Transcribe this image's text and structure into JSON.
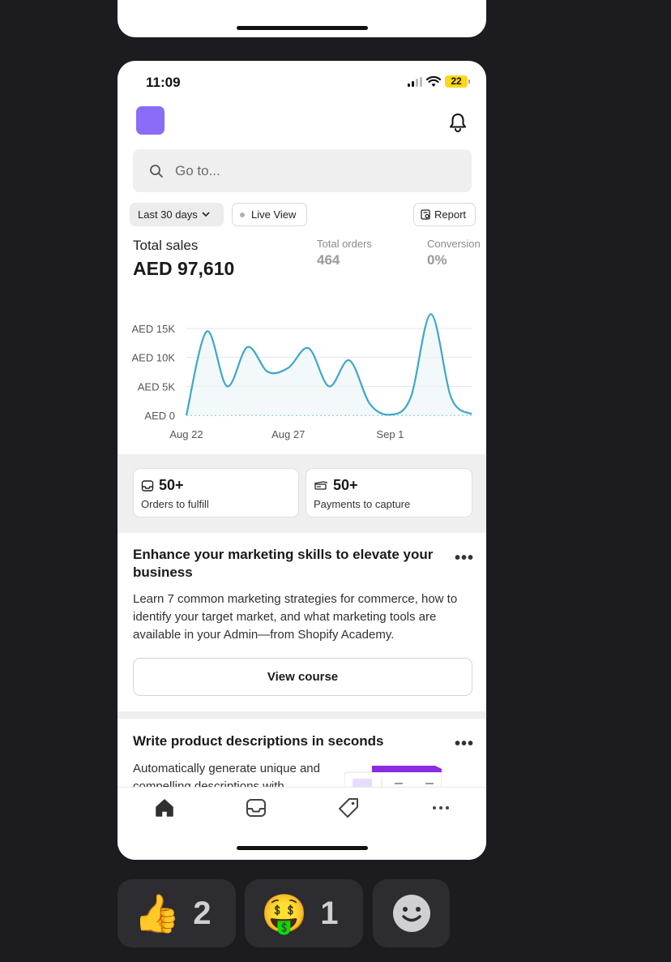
{
  "status_bar": {
    "time": "11:09",
    "battery": "22"
  },
  "search": {
    "placeholder": "Go to..."
  },
  "filters": {
    "date_range": "Last 30 days",
    "live_view": "Live View",
    "report": "Report"
  },
  "metrics": {
    "total_sales_label": "Total sales",
    "total_sales_value": "AED 97,610",
    "total_orders_label": "Total orders",
    "total_orders_value": "464",
    "conversion_label": "Conversion",
    "conversion_value": "0%"
  },
  "chart_data": {
    "type": "line",
    "title": "",
    "xlabel": "",
    "ylabel": "",
    "y_ticks": [
      "AED 15K",
      "AED 10K",
      "AED 5K",
      "AED 0"
    ],
    "x_ticks": [
      "Aug 22",
      "Aug 27",
      "Sep 1"
    ],
    "ylim": [
      0,
      15000
    ],
    "grid": true,
    "color": "#3ea7c9",
    "x": [
      "Aug 22",
      "Aug 23",
      "Aug 24",
      "Aug 25",
      "Aug 26",
      "Aug 27",
      "Aug 28",
      "Aug 29",
      "Aug 30",
      "Aug 31",
      "Sep 1",
      "Sep 2",
      "Sep 3",
      "Sep 4",
      "Sep 5"
    ],
    "values": [
      0,
      14500,
      5000,
      11800,
      7500,
      8200,
      11600,
      5000,
      9500,
      2000,
      100,
      3000,
      17500,
      3000,
      200
    ]
  },
  "tasks": [
    {
      "count": "50+",
      "label": "Orders to fulfill",
      "icon": "inbox-icon"
    },
    {
      "count": "50+",
      "label": "Payments to capture",
      "icon": "cash-icon"
    }
  ],
  "marketing_card": {
    "title": "Enhance your marketing skills to elevate your business",
    "body": "Learn 7 common marketing strategies for commerce, how to identify your target market, and what marketing tools are available in your Admin—from Shopify Academy.",
    "button": "View course",
    "more": "•••"
  },
  "product_card": {
    "title": "Write product descriptions in seconds",
    "body": "Automatically generate unique and compelling descriptions with",
    "more": "•••"
  },
  "tabbar": [
    "home-icon",
    "orders-inbox-icon",
    "products-tag-icon",
    "more-icon"
  ],
  "reactions": [
    {
      "emoji": "👍",
      "count": "2"
    },
    {
      "emoji": "🤑",
      "count": "1"
    }
  ],
  "colors": {
    "accent_purple": "#8b6cf6",
    "chart_line": "#3ea7c9",
    "battery": "#f7d81a",
    "background": "#1c1c20"
  }
}
